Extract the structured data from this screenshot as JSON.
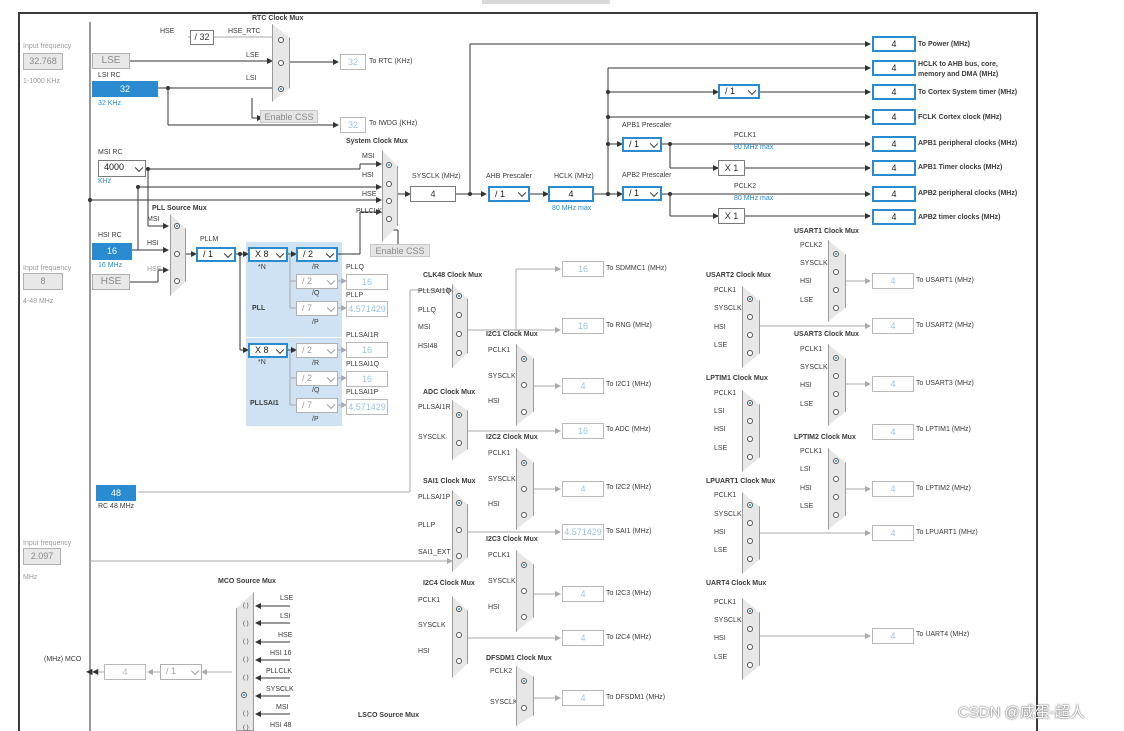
{
  "rtc_mux": {
    "title": "RTC Clock Mux",
    "hse_div": "/ 32",
    "hse_label": "HSE",
    "hse_rtc_label": "HSE_RTC",
    "lse_label": "LSE",
    "lsi_label": "LSI"
  },
  "rtc_out": {
    "value": "32",
    "label": "To RTC (KHz)"
  },
  "iwdg_out": {
    "value": "32",
    "label": "To IWDG (KHz)"
  },
  "enable_css_1": "Enable CSS",
  "enable_css_2": "Enable CSS",
  "lse": {
    "freq_title": "Input frequency",
    "freq": "32.768",
    "range": "1-1000 KHz",
    "label": "LSE"
  },
  "lsi": {
    "title": "LSI RC",
    "value": "32",
    "unit": "32 KHz"
  },
  "msi": {
    "title": "MSI RC",
    "value": "4000",
    "unit": "KHz"
  },
  "sys_mux": {
    "title": "System Clock Mux",
    "inputs": [
      "MSI",
      "HSI",
      "HSE",
      "PLLCLK"
    ]
  },
  "sysclk": {
    "label": "SYSCLK (MHz)",
    "value": "4"
  },
  "ahb": {
    "label": "AHB Prescaler",
    "value": "/ 1"
  },
  "hclk": {
    "label": "HCLK (MHz)",
    "value": "4",
    "max": "80 MHz max"
  },
  "cortex_div": "/ 1",
  "apb1": {
    "label": "APB1 Prescaler",
    "value": "/ 1",
    "pclk": "PCLK1",
    "max": "80 MHz max",
    "timer_mult": "X 1"
  },
  "apb2": {
    "label": "APB2 Prescaler",
    "value": "/ 1",
    "pclk": "PCLK2",
    "max": "80 MHz max",
    "timer_mult": "X 1"
  },
  "outputs": [
    {
      "value": "4",
      "label": "To Power (MHz)"
    },
    {
      "value": "4",
      "label": "HCLK to AHB bus, core,",
      "label2": "memory and DMA (MHz)"
    },
    {
      "value": "4",
      "label": "To Cortex System timer (MHz)"
    },
    {
      "value": "4",
      "label": "FCLK Cortex clock (MHz)"
    },
    {
      "value": "4",
      "label": "APB1 peripheral clocks (MHz)"
    },
    {
      "value": "4",
      "label": "APB1 Timer clocks (MHz)"
    },
    {
      "value": "4",
      "label": "APB2 peripheral clocks (MHz)"
    },
    {
      "value": "4",
      "label": "APB2 timer clocks (MHz)"
    }
  ],
  "pll_mux": {
    "title": "PLL Source Mux",
    "msi": "MSI",
    "hsi": "HSI",
    "hse": "HSE"
  },
  "hsi": {
    "title": "HSI RC",
    "value": "16",
    "unit": "16 MHz"
  },
  "hse": {
    "freq_title": "Input frequency",
    "freq": "8",
    "range": "4-48 MHz",
    "label": "HSE"
  },
  "pllm": {
    "label": "PLLM",
    "value": "/ 1"
  },
  "pll": {
    "n": "X 8",
    "n_label": "*N",
    "r": "/ 2",
    "r_label": "/R",
    "q": "/ 2",
    "q_label": "/Q",
    "p": "/ 7",
    "p_label": "/P",
    "name": "PLL",
    "pllq": "PLLQ",
    "pllq_val": "16",
    "pllp": "PLLP",
    "pllp_val": "4.571429"
  },
  "pllsai1": {
    "n": "X 8",
    "n_label": "*N",
    "r": "/ 2",
    "r_label": "/R",
    "q": "/ 2",
    "q_label": "/Q",
    "p": "/ 7",
    "p_label": "/P",
    "name": "PLLSAI1",
    "r_out": "PLLSAI1R",
    "r_val": "16",
    "q_out": "PLLSAI1Q",
    "q_val": "16",
    "p_out": "PLLSAI1P",
    "p_val": "4.571429"
  },
  "rc48": {
    "value": "48",
    "unit": "RC 48 MHz"
  },
  "ext": {
    "freq_title": "Input frequency",
    "freq": "2.097",
    "unit": "MHz"
  },
  "clk48": {
    "title": "CLK48 Clock Mux",
    "inputs": [
      "PLLSAI1Q",
      "PLLQ",
      "MSI",
      "HSI48"
    ],
    "sdmmc": "16",
    "sdmmc_label": "To SDMMC1 (MHz)",
    "rng": "16",
    "rng_label": "To RNG (MHz)"
  },
  "i2c1": {
    "title": "I2C1 Clock Mux",
    "inputs": [
      "PCLK1",
      "SYSCLK",
      "HSI"
    ],
    "value": "4",
    "label": "To I2C1 (MHz)"
  },
  "adc": {
    "title": "ADC Clock Mux",
    "inputs": [
      "PLLSAI1R",
      "SYSCLK"
    ],
    "value": "16",
    "label": "To ADC (MHz)"
  },
  "i2c2": {
    "title": "I2C2 Clock Mux",
    "inputs": [
      "PCLK1",
      "SYSCLK",
      "HSI"
    ],
    "value": "4",
    "label": "To I2C2 (MHz)"
  },
  "sai1": {
    "title": "SAI1 Clock Mux",
    "inputs": [
      "PLLSAI1P",
      "PLLP",
      "SAI1_EXT"
    ],
    "value": "4.571429",
    "label": "To SAI1 (MHz)"
  },
  "i2c3": {
    "title": "I2C3 Clock Mux",
    "inputs": [
      "PCLK1",
      "SYSCLK",
      "HSI"
    ],
    "value": "4",
    "label": "To I2C3 (MHz)"
  },
  "i2c4": {
    "title": "I2C4 Clock Mux",
    "inputs": [
      "PCLK1",
      "SYSCLK",
      "HSI"
    ],
    "value": "4",
    "label": "To I2C4 (MHz)"
  },
  "dfsdm1": {
    "title": "DFSDM1 Clock Mux",
    "inputs": [
      "PCLK2",
      "SYSCLK"
    ],
    "value": "4",
    "label": "To DFSDM1 (MHz)"
  },
  "usart2": {
    "title": "USART2 Clock Mux",
    "inputs": [
      "PCLK1",
      "SYSCLK",
      "HSI",
      "LSE"
    ],
    "value": "4",
    "label": "To USART2 (MHz)"
  },
  "usart1": {
    "title": "USART1 Clock Mux",
    "inputs": [
      "PCLK2",
      "SYSCLK",
      "HSI",
      "LSE"
    ],
    "value": "4",
    "label": "To USART1 (MHz)"
  },
  "usart3": {
    "title": "USART3 Clock Mux",
    "inputs": [
      "PCLK1",
      "SYSCLK",
      "HSI",
      "LSE"
    ],
    "value": "4",
    "label": "To USART3 (MHz)"
  },
  "lptim1": {
    "title": "LPTIM1 Clock Mux",
    "inputs": [
      "PCLK1",
      "LSI",
      "HSI",
      "LSE"
    ],
    "value": "4",
    "label": "To LPTIM1 (MHz)"
  },
  "lptim2": {
    "title": "LPTIM2 Clock Mux",
    "inputs": [
      "PCLK1",
      "LSI",
      "HSI",
      "LSE"
    ],
    "value": "4",
    "label": "To LPTIM2 (MHz)"
  },
  "lpuart1": {
    "title": "LPUART1 Clock Mux",
    "inputs": [
      "PCLK1",
      "SYSCLK",
      "HSI",
      "LSE"
    ],
    "value": "4",
    "label": "To LPUART1 (MHz)"
  },
  "uart4": {
    "title": "UART4 Clock Mux",
    "inputs": [
      "PCLK1",
      "SYSCLK",
      "HSI",
      "LSE"
    ],
    "value": "4",
    "label": "To UART4 (MHz)"
  },
  "mco": {
    "title": "MCO Source Mux",
    "inputs": [
      "LSE",
      "LSI",
      "HSE",
      "HSI 16",
      "PLLCLK",
      "SYSCLK",
      "MSI",
      "HSI 48"
    ],
    "label": "(MHz) MCO",
    "value": "4",
    "div": "/ 1"
  },
  "lsco": {
    "title": "LSCO Source Mux"
  },
  "watermark": "CSDN @咸蛋-超人",
  "colors": {
    "accent": "#2b8bd0",
    "pll_shade": "#cfe2f3",
    "mux_fill": "#e7e7e7"
  }
}
